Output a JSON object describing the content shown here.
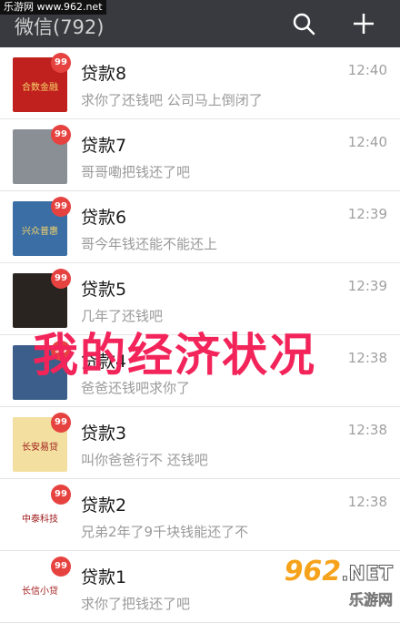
{
  "watermark_top": "乐游网 www.962.net",
  "header": {
    "title": "微信(792)"
  },
  "chats": [
    {
      "name": "贷款8",
      "message": "求你了还钱吧 公司马上倒闭了",
      "time": "12:40",
      "badge": "99",
      "avatar_text": "合数金融",
      "avatar_bg": "#c0201e"
    },
    {
      "name": "贷款7",
      "message": "哥哥嘞把钱还了吧",
      "time": "12:40",
      "badge": "99",
      "avatar_text": "",
      "avatar_bg": "#8a8f96"
    },
    {
      "name": "贷款6",
      "message": "哥今年钱还能不能还上",
      "time": "12:39",
      "badge": "99",
      "avatar_text": "兴众普惠",
      "avatar_bg": "#3a6ea5"
    },
    {
      "name": "贷款5",
      "message": "几年了还钱吧",
      "time": "12:39",
      "badge": "99",
      "avatar_text": "",
      "avatar_bg": "#2a2420"
    },
    {
      "name": "贷款4",
      "message": "爸爸还钱吧求你了",
      "time": "12:38",
      "badge": "99",
      "avatar_text": "",
      "avatar_bg": "#3b5f8a"
    },
    {
      "name": "贷款3",
      "message": "叫你爸爸行不  还钱吧",
      "time": "12:38",
      "badge": "99",
      "avatar_text": "长安易贷",
      "avatar_bg": "#f3e0a0"
    },
    {
      "name": "贷款2",
      "message": "兄弟2年了9千块钱能还了不",
      "time": "12:38",
      "badge": "99",
      "avatar_text": "中泰科技",
      "avatar_bg": "#ffffff"
    },
    {
      "name": "贷款1",
      "message": "求你了把钱还了吧",
      "time": "12:37",
      "badge": "99",
      "avatar_text": "长信小贷",
      "avatar_bg": "#ffffff"
    }
  ],
  "overlay_text": "我的经济状况",
  "watermark_bottom": {
    "brand": "962",
    "net": ".NET",
    "sub": "乐游网"
  }
}
